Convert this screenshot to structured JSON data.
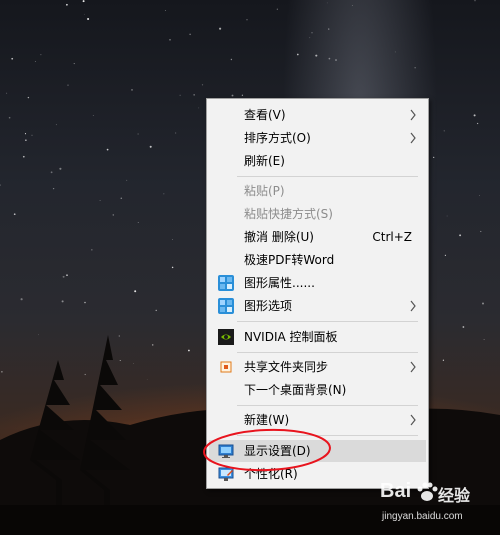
{
  "menu": {
    "items": [
      {
        "label": "查看(V)",
        "submenu": true,
        "disabled": false,
        "icon": ""
      },
      {
        "label": "排序方式(O)",
        "submenu": true,
        "disabled": false,
        "icon": ""
      },
      {
        "label": "刷新(E)",
        "submenu": false,
        "disabled": false,
        "icon": ""
      },
      {
        "label": "粘贴(P)",
        "submenu": false,
        "disabled": true,
        "icon": ""
      },
      {
        "label": "粘贴快捷方式(S)",
        "submenu": false,
        "disabled": true,
        "icon": ""
      },
      {
        "label": "撤消 删除(U)",
        "shortcut": "Ctrl+Z",
        "submenu": false,
        "disabled": false,
        "icon": ""
      },
      {
        "label": "极速PDF转Word",
        "submenu": false,
        "disabled": false,
        "icon": ""
      },
      {
        "label": "图形属性......",
        "submenu": false,
        "disabled": false,
        "icon": "intel-graphics-icon"
      },
      {
        "label": "图形选项",
        "submenu": true,
        "disabled": false,
        "icon": "intel-graphics-icon"
      },
      {
        "label": "NVIDIA 控制面板",
        "submenu": false,
        "disabled": false,
        "icon": "nvidia-icon"
      },
      {
        "label": "共享文件夹同步",
        "submenu": true,
        "disabled": false,
        "icon": "sync-icon"
      },
      {
        "label": "下一个桌面背景(N)",
        "submenu": false,
        "disabled": false,
        "icon": ""
      },
      {
        "label": "新建(W)",
        "submenu": true,
        "disabled": false,
        "icon": ""
      },
      {
        "label": "显示设置(D)",
        "submenu": false,
        "disabled": false,
        "highlighted": true,
        "icon": "display-icon"
      },
      {
        "label": "个性化(R)",
        "submenu": false,
        "disabled": false,
        "icon": "personalize-icon"
      }
    ]
  },
  "watermark": {
    "brand": "Bai",
    "brand_suffix": "经验",
    "url": "jingyan.baidu.com"
  },
  "colors": {
    "menu_bg": "#f2f2f2",
    "highlight": "#dadada",
    "annotation_circle": "#e8141e",
    "disabled_text": "#8c8c8c"
  }
}
